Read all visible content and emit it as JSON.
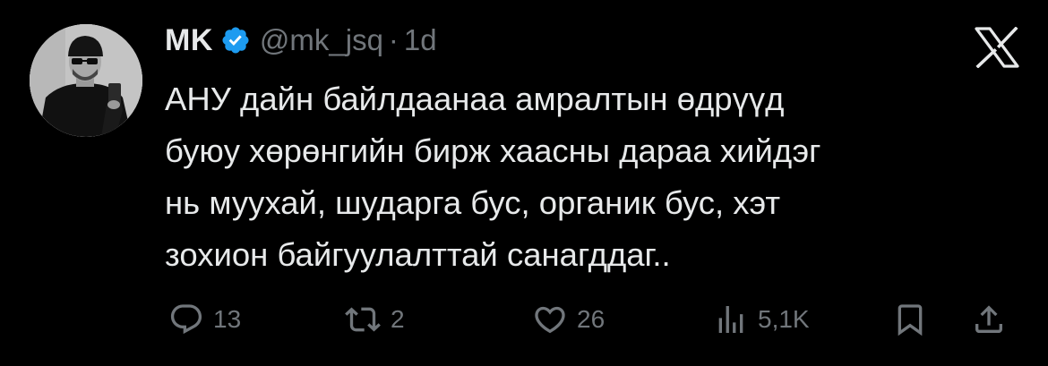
{
  "tweet": {
    "author": {
      "display_name": "MK",
      "handle": "@mk_jsq",
      "verified": true,
      "avatar_icon": "profile-photo-icon"
    },
    "separator": "·",
    "time": "1d",
    "brand_icon": "x-logo-icon",
    "text_lines": [
      "АНУ дайн байлдаанаа амралтын өдрүүд",
      "буюу хөрөнгийн бирж хаасны дараа хийдэг",
      "нь муухай, шударга бус, органик бус, хэт",
      "зохион байгуулалттай санагддаг.."
    ],
    "actions": {
      "replies": "13",
      "reposts": "2",
      "likes": "26",
      "views": "5,1K"
    }
  },
  "colors": {
    "background": "#000000",
    "primary_text": "#e7e9ea",
    "secondary_text": "#71767b",
    "verified_blue": "#1d9bf0"
  }
}
